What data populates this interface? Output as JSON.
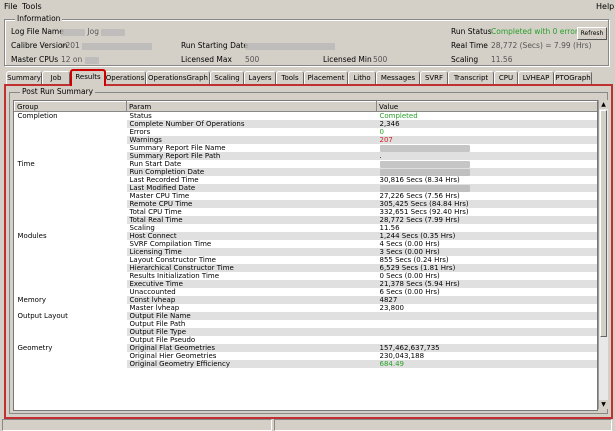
{
  "menu": {
    "file": "File",
    "tools": "Tools",
    "help": "Help"
  },
  "info": {
    "title": "Information",
    "log_file_label": "Log File Name",
    "log_file_value": "Jog",
    "calibre_version_label": "Calibre Version",
    "calibre_version_value": "v201",
    "master_cpus_label": "Master CPUs",
    "master_cpus_value": "12 on",
    "run_start_label": "Run Starting Date",
    "licensed_max_label": "Licensed Max",
    "licensed_max_value": "500",
    "licensed_min_label": "Licensed Min",
    "licensed_min_value": "500",
    "run_status_label": "Run Status",
    "run_status_value": "Completed with 0 errors",
    "real_time_label": "Real Time",
    "real_time_value": "28,772 (Secs) = 7.99 (Hrs)",
    "scaling_label": "Scaling",
    "scaling_value": "11.56",
    "refresh": "Refresh"
  },
  "tabs": [
    "Summary",
    "Job",
    "Results",
    "Operations",
    "OperationsGraph",
    "Scaling",
    "Layers",
    "Tools",
    "Placement",
    "Litho",
    "Messages",
    "SVRF",
    "Transcript",
    "CPU",
    "LVHEAP",
    "PTOGraph"
  ],
  "summary": {
    "title": "Post Run Summary",
    "headers": {
      "group": "Group",
      "param": "Param",
      "value": "Value"
    },
    "rows": [
      {
        "group": "Completion",
        "param": "Status",
        "value": "Completed",
        "cls": "ok"
      },
      {
        "group": "",
        "param": "Complete Number Of Operations",
        "value": "2,346"
      },
      {
        "group": "",
        "param": "Errors",
        "value": "0",
        "cls": "ok"
      },
      {
        "group": "",
        "param": "Warnings",
        "value": "207",
        "cls": "warn"
      },
      {
        "group": "",
        "param": "Summary Report File Name",
        "value": "",
        "blur": true
      },
      {
        "group": "",
        "param": "Summary Report File Path",
        "value": "."
      },
      {
        "group": "Time",
        "param": "Run Start Date",
        "value": "",
        "blur": true
      },
      {
        "group": "",
        "param": "Run Completion Date",
        "value": "",
        "blur": true
      },
      {
        "group": "",
        "param": "Last Recorded Time",
        "value": "30,816 Secs (8.34 Hrs)"
      },
      {
        "group": "",
        "param": "Last Modified Date",
        "value": "",
        "blur": true
      },
      {
        "group": "",
        "param": "Master CPU Time",
        "value": "27,226 Secs (7.56 Hrs)"
      },
      {
        "group": "",
        "param": "Remote CPU Time",
        "value": "305,425 Secs (84.84 Hrs)"
      },
      {
        "group": "",
        "param": "Total CPU Time",
        "value": "332,651 Secs (92.40 Hrs)"
      },
      {
        "group": "",
        "param": "Total Real Time",
        "value": "28,772 Secs (7.99 Hrs)"
      },
      {
        "group": "",
        "param": "Scaling",
        "value": "11.56"
      },
      {
        "group": "Modules",
        "param": "Host Connect",
        "value": "1,244 Secs (0.35 Hrs)"
      },
      {
        "group": "",
        "param": "SVRF Compilation Time",
        "value": "4 Secs (0.00 Hrs)"
      },
      {
        "group": "",
        "param": "Licensing Time",
        "value": "3 Secs (0.00 Hrs)"
      },
      {
        "group": "",
        "param": "Layout Constructor Time",
        "value": "855 Secs (0.24 Hrs)"
      },
      {
        "group": "",
        "param": "Hierarchical Constructor Time",
        "value": "6,529 Secs (1.81 Hrs)"
      },
      {
        "group": "",
        "param": "Results Initialization Time",
        "value": "0 Secs (0.00 Hrs)"
      },
      {
        "group": "",
        "param": "Executive Time",
        "value": "21,378 Secs (5.94 Hrs)"
      },
      {
        "group": "",
        "param": "Unaccounted",
        "value": "6 Secs (0.00 Hrs)"
      },
      {
        "group": "Memory",
        "param": "Const lvheap",
        "value": "4827"
      },
      {
        "group": "",
        "param": "Master lvheap",
        "value": "23,800"
      },
      {
        "group": "Output Layout",
        "param": "Output File Name",
        "value": ""
      },
      {
        "group": "",
        "param": "Output File Path",
        "value": ""
      },
      {
        "group": "",
        "param": "Output File Type",
        "value": ""
      },
      {
        "group": "",
        "param": "Output File Pseudo",
        "value": ""
      },
      {
        "group": "Geometry",
        "param": "Original Flat Geometries",
        "value": "157,462,637,735"
      },
      {
        "group": "",
        "param": "Original Hier Geometries",
        "value": "230,043,188"
      },
      {
        "group": "",
        "param": "Original Geometry Efficiency",
        "value": "684.49",
        "cls": "ok"
      }
    ]
  }
}
